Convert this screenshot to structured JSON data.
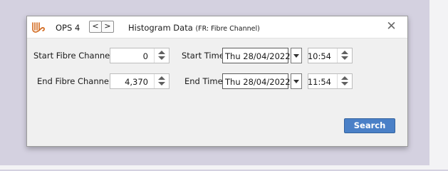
{
  "colors": {
    "accent": "#4a80c7",
    "logo": "#d2691e"
  },
  "app": {
    "logo_icon": "ops-logo-icon",
    "name": "OPS 4"
  },
  "nav": {
    "back_label": "<",
    "forward_label": ">"
  },
  "window": {
    "title": "Histogram Data",
    "subtitle": "(FR: Fibre Channel)",
    "close_icon": "close-icon"
  },
  "form": {
    "start_channel": {
      "label": "Start Fibre Channel",
      "value": "0"
    },
    "end_channel": {
      "label": "End Fibre Channel",
      "value": "4,370"
    },
    "start_time": {
      "label": "Start Time",
      "date": "Thu 28/04/2022",
      "time": "10:54"
    },
    "end_time": {
      "label": "End Time",
      "date": "Thu 28/04/2022",
      "time": "11:54"
    }
  },
  "search_label": "Search"
}
